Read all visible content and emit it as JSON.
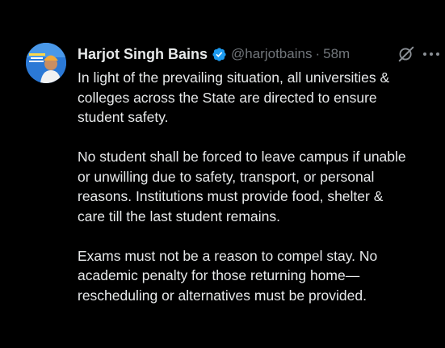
{
  "tweet": {
    "author_name": "Harjot Singh Bains",
    "handle": "@harjotbains",
    "separator": "·",
    "time": "58m",
    "avatar_icon": "profile-photo",
    "verified_icon": "verified-badge",
    "verified_color": "#1d9bf0",
    "grok_icon": "grok-icon",
    "more_icon": "more-icon",
    "paragraphs": [
      [
        "In light of the prevailing situation, all universities &",
        "colleges across the State are directed to ensure",
        "student safety."
      ],
      [
        "No student shall be forced to leave campus if unable",
        "or unwilling due to safety, transport, or personal",
        "reasons. Institutions must provide food, shelter &",
        "care till the last student remains."
      ],
      [
        "Exams must not be a reason to compel stay. No",
        "academic penalty for those returning home—",
        "rescheduling or alternatives must be provided."
      ]
    ]
  }
}
